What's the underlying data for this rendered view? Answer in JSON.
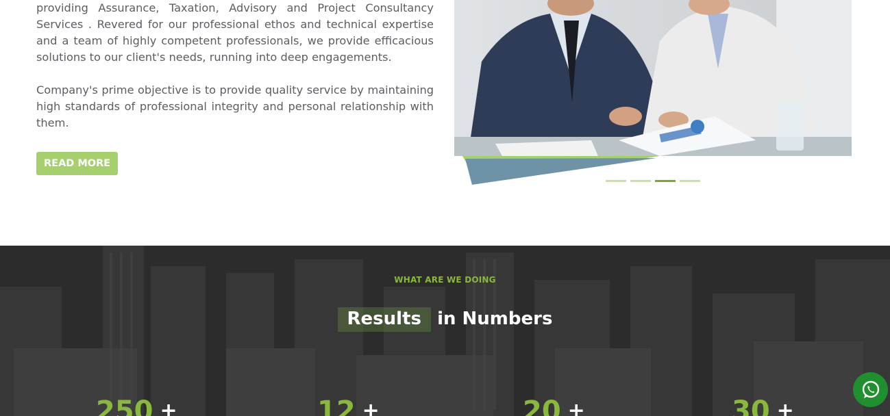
{
  "about": {
    "paragraph_1": "providing Assurance, Taxation, Advisory and Project Consultancy Services . Revered for our professional ethos and technical expertise and a team of highly competent professionals, we provide efficacious solutions to our client's needs, running into deep engagements.",
    "paragraph_2": "Company's prime objective is to provide quality service by maintaining high standards of professional integrity and personal relationship with them.",
    "read_more_label": "READ MORE"
  },
  "carousel": {
    "slide_count": 4,
    "active_index": 2
  },
  "numbers": {
    "eyebrow": "WHAT ARE WE DOING",
    "heading_highlight": "Results",
    "heading_rest": "in Numbers",
    "stats": [
      {
        "value": "250",
        "suffix": "+"
      },
      {
        "value": "12",
        "suffix": "+"
      },
      {
        "value": "20",
        "suffix": "+"
      },
      {
        "value": "30",
        "suffix": "+"
      }
    ]
  },
  "colors": {
    "accent_green": "#8ab83f",
    "button_green": "#a6cf6e",
    "whatsapp_green": "#1f8f2f"
  },
  "icons": {
    "whatsapp": "whatsapp-icon"
  }
}
